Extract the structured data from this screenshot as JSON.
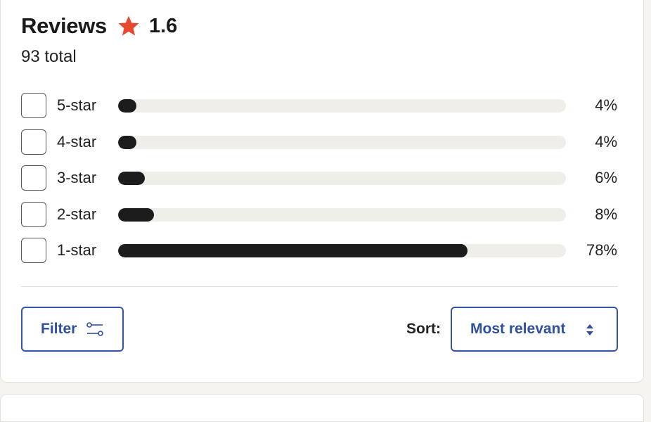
{
  "reviews": {
    "title": "Reviews",
    "rating": "1.6",
    "total": "93 total",
    "star_color": "#e8482e"
  },
  "breakdown": [
    {
      "label": "5-star",
      "percent_text": "4%",
      "fraction": 0.04
    },
    {
      "label": "4-star",
      "percent_text": "4%",
      "fraction": 0.04
    },
    {
      "label": "3-star",
      "percent_text": "6%",
      "fraction": 0.06
    },
    {
      "label": "2-star",
      "percent_text": "8%",
      "fraction": 0.08
    },
    {
      "label": "1-star",
      "percent_text": "78%",
      "fraction": 0.78
    }
  ],
  "controls": {
    "filter_label": "Filter",
    "filter_icon": "sliders-icon",
    "sort_label": "Sort:",
    "sort_value": "Most relevant",
    "sort_icon": "updown-chevron-icon",
    "accent_color": "#3355a8"
  }
}
